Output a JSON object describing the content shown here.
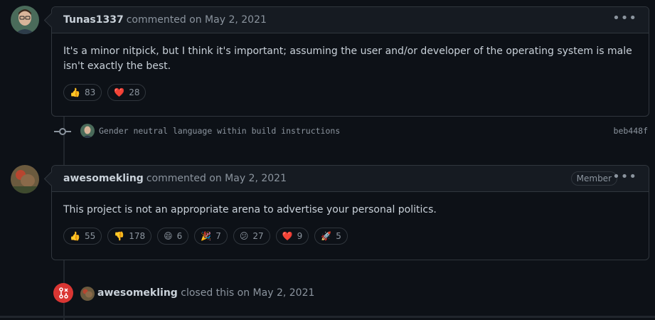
{
  "comment1": {
    "author": "Tunas1337",
    "meta": "commented on May 2, 2021",
    "body": "It's a minor nitpick, but I think it's important; assuming the user and/or developer of the operating system is male isn't exactly the best.",
    "reactions": [
      {
        "emoji": "👍",
        "count": "83"
      },
      {
        "emoji": "❤️",
        "count": "28"
      }
    ]
  },
  "commit": {
    "message": "Gender neutral language within build instructions",
    "sha": "beb448f"
  },
  "comment2": {
    "author": "awesomekling",
    "meta": "commented on May 2, 2021",
    "badge": "Member",
    "body": "This project is not an appropriate arena to advertise your personal politics.",
    "reactions": [
      {
        "emoji": "👍",
        "count": "55"
      },
      {
        "emoji": "👎",
        "count": "178"
      },
      {
        "emoji": "😄",
        "count": "6"
      },
      {
        "emoji": "🎉",
        "count": "7"
      },
      {
        "emoji": "😕",
        "count": "27"
      },
      {
        "emoji": "❤️",
        "count": "9"
      },
      {
        "emoji": "🚀",
        "count": "5"
      }
    ]
  },
  "closed_event": {
    "actor": "awesomekling",
    "text": "closed this on May 2, 2021"
  },
  "icons": {
    "more_options": "kebab-horizontal-icon",
    "closed": "issue-closed-icon",
    "commit": "git-commit-icon"
  },
  "colors": {
    "background": "#0d1117",
    "border": "#30363d",
    "header_bg": "#161b22",
    "closed_red": "#da3633",
    "muted_text": "#8b949e"
  }
}
